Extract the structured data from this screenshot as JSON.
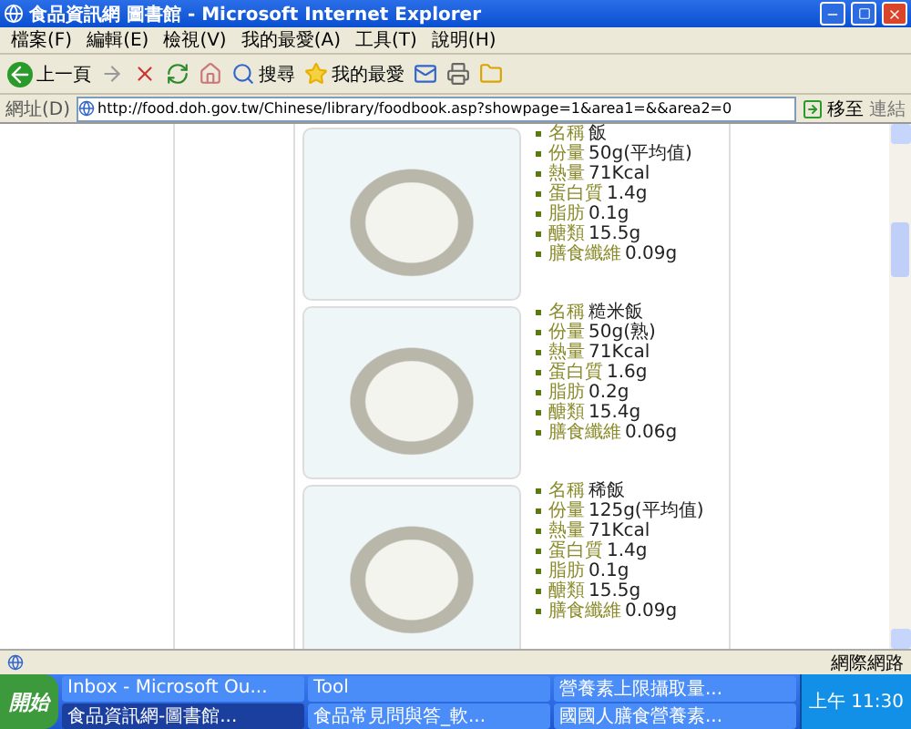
{
  "window": {
    "title": "食品資訊網 圖書館 - Microsoft Internet Explorer"
  },
  "menu": [
    "檔案(F)",
    "編輯(E)",
    "檢視(V)",
    "我的最愛(A)",
    "工具(T)",
    "說明(H)"
  ],
  "toolbar": {
    "back": "上一頁",
    "search": "搜尋",
    "favorites": "我的最愛"
  },
  "address": {
    "label": "網址(D)",
    "url": "http://food.doh.gov.tw/Chinese/library/foodbook.asp?showpage=1&area1=&&area2=0",
    "go": "移至",
    "links": "連結"
  },
  "foods": [
    {
      "rows": [
        {
          "label": "名稱",
          "value": "飯"
        },
        {
          "label": "份量",
          "value": "50g(平均值)"
        },
        {
          "label": "熱量",
          "value": "71Kcal"
        },
        {
          "label": "蛋白質",
          "value": "1.4g"
        },
        {
          "label": "脂肪",
          "value": "0.1g"
        },
        {
          "label": "醣類",
          "value": "15.5g"
        },
        {
          "label": "膳食纖維",
          "value": "0.09g"
        }
      ]
    },
    {
      "rows": [
        {
          "label": "名稱",
          "value": "糙米飯"
        },
        {
          "label": "份量",
          "value": "50g(熟)"
        },
        {
          "label": "熱量",
          "value": "71Kcal"
        },
        {
          "label": "蛋白質",
          "value": "1.6g"
        },
        {
          "label": "脂肪",
          "value": "0.2g"
        },
        {
          "label": "醣類",
          "value": "15.4g"
        },
        {
          "label": "膳食纖維",
          "value": "0.06g"
        }
      ]
    },
    {
      "rows": [
        {
          "label": "名稱",
          "value": "稀飯"
        },
        {
          "label": "份量",
          "value": "125g(平均值)"
        },
        {
          "label": "熱量",
          "value": "71Kcal"
        },
        {
          "label": "蛋白質",
          "value": "1.4g"
        },
        {
          "label": "脂肪",
          "value": "0.1g"
        },
        {
          "label": "醣類",
          "value": "15.5g"
        },
        {
          "label": "膳食纖維",
          "value": "0.09g"
        }
      ]
    }
  ],
  "status_bar": {
    "zone": "網際網路"
  },
  "taskbar": {
    "start": "開始",
    "items": [
      {
        "label": "Inbox - Microsoft Ou...",
        "selected": false
      },
      {
        "label": "Tool",
        "selected": false
      },
      {
        "label": "營養素上限攝取量...",
        "selected": false
      },
      {
        "label": "食品資訊網-圖書館...",
        "selected": true
      },
      {
        "label": "食品常見問與答_軟...",
        "selected": false
      },
      {
        "label": "國國人膳食營養素...",
        "selected": false
      }
    ],
    "clock": "上午 11:30"
  }
}
